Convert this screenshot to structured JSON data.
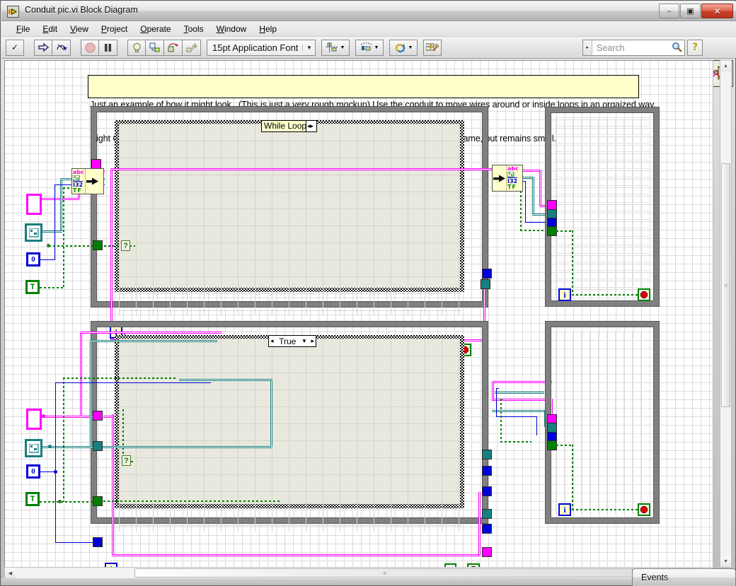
{
  "window": {
    "title": "Conduit pic.vi Block Diagram",
    "app_icon": "labview-vi-icon",
    "controls": {
      "minimize": "minimize-icon",
      "restore": "restore-icon",
      "close": "close-icon",
      "minimize_glyph": "–",
      "restore_glyph": "▣",
      "close_glyph": "✕"
    }
  },
  "menubar": {
    "items": [
      {
        "label": "File",
        "mnemonic": "F"
      },
      {
        "label": "Edit",
        "mnemonic": "E"
      },
      {
        "label": "View",
        "mnemonic": "V"
      },
      {
        "label": "Project",
        "mnemonic": "P"
      },
      {
        "label": "Operate",
        "mnemonic": "O"
      },
      {
        "label": "Tools",
        "mnemonic": "T"
      },
      {
        "label": "Window",
        "mnemonic": "W"
      },
      {
        "label": "Help",
        "mnemonic": "H"
      }
    ]
  },
  "toolbar": {
    "buttons": [
      {
        "name": "run-button",
        "icon": "checkmark-icon",
        "glyph": "✓"
      },
      {
        "name": "run-continuously-button",
        "icon": "run-arrow-icon",
        "glyph": "⇨"
      },
      {
        "name": "retain-wire-values-button",
        "icon": "retain-wire-icon",
        "glyph": "⥁"
      },
      {
        "name": "abort-execution-button",
        "icon": "stop-sign-icon",
        "glyph": "⬣"
      },
      {
        "name": "pause-button",
        "icon": "pause-icon",
        "glyph": "▐▌"
      },
      {
        "name": "highlight-execution-button",
        "icon": "lightbulb-icon",
        "glyph": "○"
      },
      {
        "name": "step-into-button",
        "icon": "step-into-icon",
        "glyph": "↳"
      },
      {
        "name": "step-over-button",
        "icon": "step-over-icon",
        "glyph": "↷"
      },
      {
        "name": "step-out-button",
        "icon": "step-out-icon",
        "glyph": "↱"
      }
    ],
    "font_selector": {
      "value": "15pt Application Font",
      "arrow": "▼"
    },
    "dropdowns": [
      {
        "name": "align-objects-dropdown",
        "icon": "align-objects-icon",
        "glyph": "┳"
      },
      {
        "name": "distribute-objects-dropdown",
        "icon": "distribute-objects-icon",
        "glyph": "⬚"
      },
      {
        "name": "reorder-dropdown",
        "icon": "reorder-icon",
        "glyph": "⟳"
      },
      {
        "name": "clean-up-diagram-button",
        "icon": "clean-up-diagram-icon",
        "glyph": "✎"
      }
    ],
    "search": {
      "placeholder": "Search",
      "value": "",
      "icon": "search-magnifier-icon",
      "dropdown_glyph": "▸"
    },
    "help_button": {
      "label": "?",
      "icon": "question-mark-icon"
    },
    "context_help": {
      "icon": "context-help-wire-icon"
    }
  },
  "diagram": {
    "free_label": {
      "line1": "Just an example of how it might look.  (This is just a very rough mockup) Use the conduit to move wires around or inside loops in an orgaized way.",
      "line2": "Right Click to create and add connectors.  Choose from wires in the conduit like a unbundle by name, but remains small."
    },
    "structures": [
      {
        "name": "while-loop-top",
        "label": "While Loop",
        "type": "while-loop",
        "has_selector": false
      },
      {
        "name": "case-structure-bottom",
        "label": "True",
        "type": "case-structure",
        "has_selector": true,
        "left_arrow": "◂",
        "right_arrow": "▸",
        "dropdown": "▼"
      },
      {
        "name": "subdiagram-top-right",
        "label": "",
        "type": "while-loop",
        "has_selector": false
      },
      {
        "name": "subdiagram-bottom-right",
        "label": "",
        "type": "while-loop",
        "has_selector": false
      }
    ],
    "controls": [
      {
        "name": "string-control",
        "type": "string",
        "label": "",
        "color": "#ff00ff",
        "glyph": ""
      },
      {
        "name": "cluster-control",
        "type": "cluster",
        "label": "",
        "color": "#177f7f",
        "glyph": ""
      },
      {
        "name": "numeric-constant",
        "type": "numeric",
        "label": "0",
        "color": "#0000d8",
        "glyph": "0"
      },
      {
        "name": "boolean-constant",
        "type": "boolean",
        "label": "T",
        "color": "#008000",
        "glyph": "T"
      }
    ],
    "conduit_node": {
      "types": [
        "abc",
        "cluster",
        "I32",
        "TF"
      ],
      "type_labels": {
        "string": "abc",
        "cluster": "⬚",
        "integer": "I32",
        "boolean": "TF"
      },
      "arrow_glyph": "➤"
    },
    "terminals": {
      "iteration_label": "i",
      "stop_icon": "stop-octagon-icon",
      "boolean_true_label": "T",
      "question_icon": "?"
    },
    "wire_colors": {
      "string": "#ff00ff",
      "cluster": "#177f7f",
      "integer": "#0000d8",
      "boolean": "#008000"
    },
    "structure_colors": {
      "border": "#808080",
      "subdiagram": "#e8e8de"
    }
  },
  "scrollbars": {
    "vertical": {
      "up": "▲",
      "down": "▼",
      "grip": "≡"
    },
    "horizontal": {
      "left": "◀",
      "right": "▶",
      "grip": "⦀"
    }
  },
  "docked_window": {
    "title": "Events"
  }
}
